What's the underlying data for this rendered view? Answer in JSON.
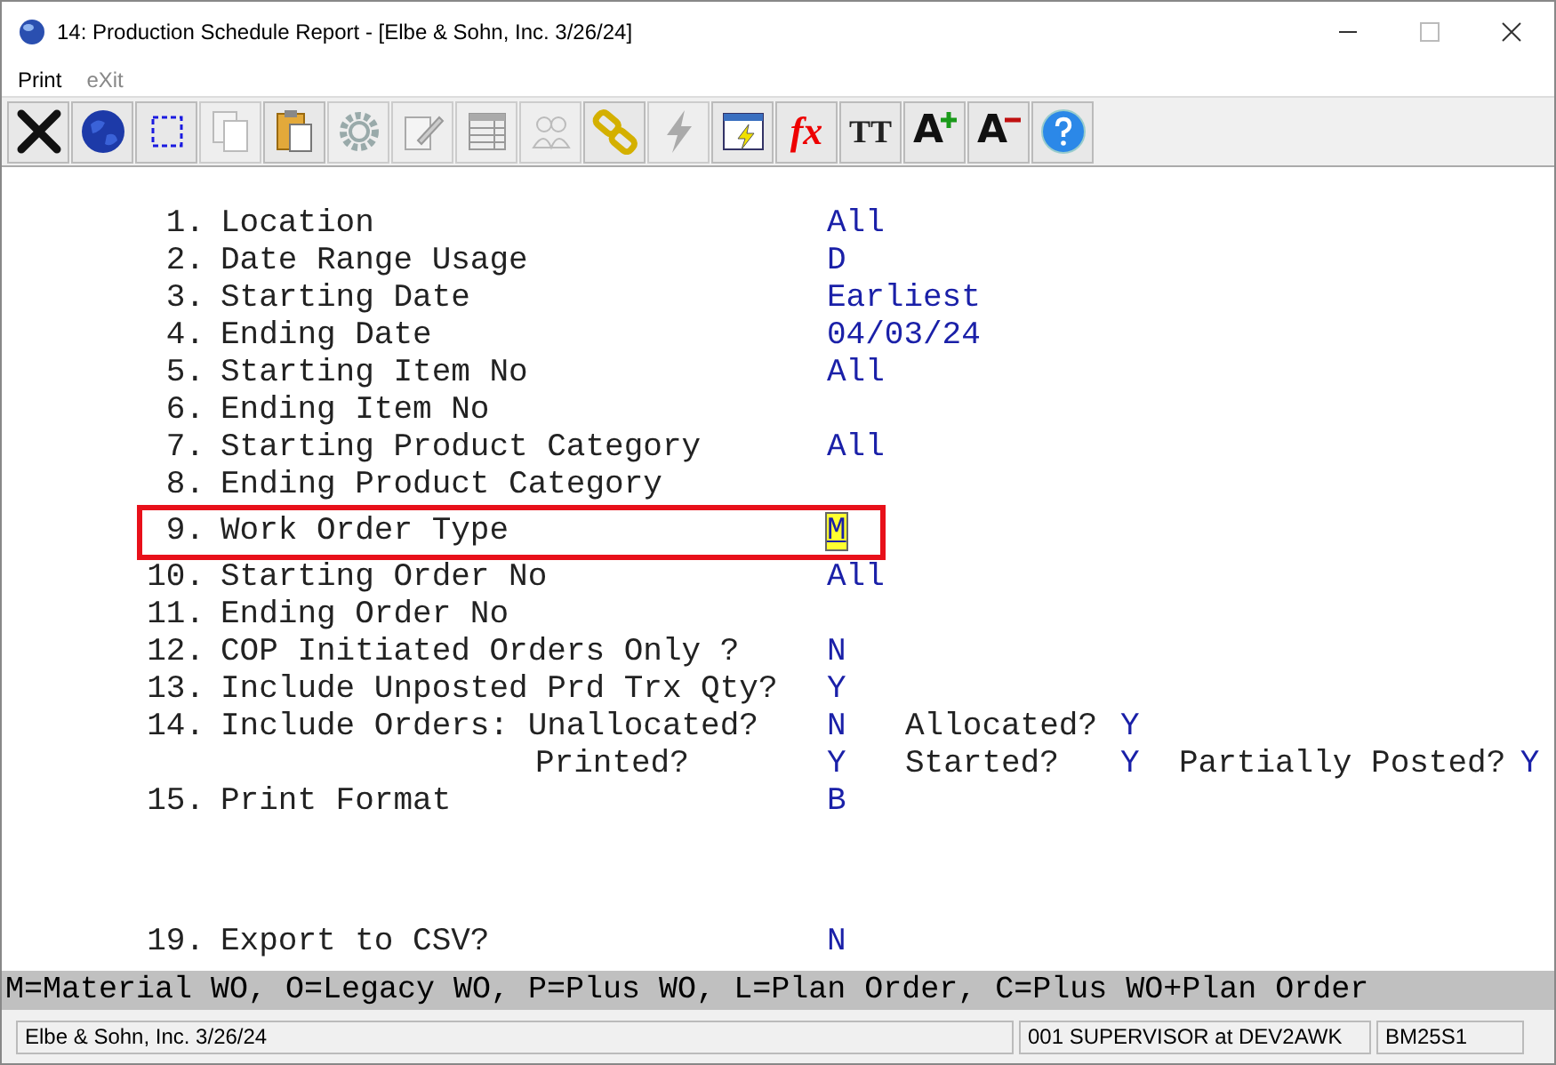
{
  "window": {
    "title": "14: Production Schedule Report - [Elbe & Sohn, Inc. 3/26/24]"
  },
  "menu": [
    {
      "label": "Print",
      "disabled": false
    },
    {
      "label": "eXit",
      "disabled": true
    }
  ],
  "toolbar": [
    {
      "kind": "close",
      "disabled": false
    },
    {
      "kind": "globe",
      "disabled": false
    },
    {
      "kind": "select",
      "disabled": false
    },
    {
      "kind": "copy",
      "disabled": true
    },
    {
      "kind": "paste",
      "disabled": false
    },
    {
      "kind": "gear",
      "disabled": true
    },
    {
      "kind": "edit",
      "disabled": true
    },
    {
      "kind": "table",
      "disabled": true
    },
    {
      "kind": "people",
      "disabled": true
    },
    {
      "kind": "link",
      "disabled": false
    },
    {
      "kind": "bolt",
      "disabled": true
    },
    {
      "kind": "window-bolt",
      "disabled": false
    },
    {
      "kind": "text",
      "glyph": "fx",
      "disabled": false
    },
    {
      "kind": "text",
      "glyph": "TT",
      "disabled": false
    },
    {
      "kind": "font-up",
      "glyph": "A",
      "disabled": false
    },
    {
      "kind": "font-down",
      "glyph": "A",
      "disabled": false
    },
    {
      "kind": "help",
      "disabled": false
    }
  ],
  "options": [
    {
      "num": "1.",
      "label": "Location",
      "value": "All"
    },
    {
      "num": "2.",
      "label": "Date Range Usage",
      "value": "D"
    },
    {
      "num": "3.",
      "label": "Starting Date",
      "value": "Earliest"
    },
    {
      "num": "4.",
      "label": "Ending Date",
      "value": "04/03/24"
    },
    {
      "num": "5.",
      "label": "Starting Item No",
      "value": "All"
    },
    {
      "num": "6.",
      "label": "Ending Item No"
    },
    {
      "num": "7.",
      "label": "Starting Product Category",
      "value": "All"
    },
    {
      "num": "8.",
      "label": "Ending Product Category"
    },
    {
      "num": "9.",
      "label": "Work Order Type",
      "value": "M",
      "focused": true,
      "outlined": true
    },
    {
      "num": "10.",
      "label": "Starting Order No",
      "value": "All"
    },
    {
      "num": "11.",
      "label": "Ending Order No"
    },
    {
      "num": "12.",
      "label": "COP Initiated Orders Only ?",
      "value": "N"
    },
    {
      "num": "13.",
      "label": "Include Unposted Prd Trx Qty?",
      "value": "Y"
    },
    {
      "num": "14.",
      "label": "Include Orders: Unallocated?",
      "value": "N",
      "extras": [
        {
          "label": "Allocated?",
          "value": "Y"
        }
      ]
    },
    {
      "kind": "continuation",
      "label": "Printed?",
      "value": "Y",
      "extras": [
        {
          "label": "Started?",
          "value": "Y"
        },
        {
          "label": "Partially Posted?",
          "value": "Y"
        }
      ]
    },
    {
      "num": "15.",
      "label": "Print Format",
      "value": "B"
    }
  ],
  "export_options": [
    {
      "num": "19.",
      "label": "Export to CSV?",
      "value": "N"
    }
  ],
  "hint": "M=Material WO, O=Legacy WO, P=Plus WO, L=Plan Order, C=Plus WO+Plan Order",
  "status_bar": {
    "company": "Elbe & Sohn, Inc. 3/26/24",
    "user": "001 SUPERVISOR at DEV2AWK",
    "program": "BM25S1"
  }
}
